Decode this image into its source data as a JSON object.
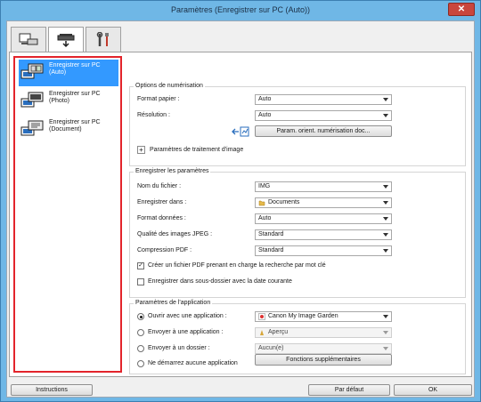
{
  "window": {
    "title": "Paramètres (Enregistrer sur PC (Auto))",
    "close": "✕"
  },
  "tabs": [
    {
      "icon": "scanner-computer-icon"
    },
    {
      "icon": "scanner-save-icon"
    },
    {
      "icon": "tools-icon"
    }
  ],
  "sidebar": {
    "items": [
      {
        "label": "Enregistrer sur PC\n(Auto)",
        "selected": true
      },
      {
        "label": "Enregistrer sur PC\n(Photo)",
        "selected": false
      },
      {
        "label": "Enregistrer sur PC\n(Document)",
        "selected": false
      }
    ]
  },
  "scan_options": {
    "title": "Options de numérisation",
    "paper_size_label": "Format papier :",
    "paper_size_value": "Auto",
    "resolution_label": "Résolution :",
    "resolution_value": "Auto",
    "orientation_button": "Param. orient. numérisation doc...",
    "image_processing_label": "Paramètres de traitement d'image",
    "expand_symbol": "+"
  },
  "save_settings": {
    "title": "Enregistrer les paramètres",
    "filename_label": "Nom du fichier :",
    "filename_value": "IMG",
    "save_in_label": "Enregistrer dans :",
    "save_in_value": "Documents",
    "data_format_label": "Format données :",
    "data_format_value": "Auto",
    "jpeg_quality_label": "Qualité des images JPEG :",
    "jpeg_quality_value": "Standard",
    "pdf_compression_label": "Compression PDF :",
    "pdf_compression_value": "Standard",
    "searchable_pdf_label": "Créer un fichier PDF prenant en charge la recherche par mot clé",
    "searchable_pdf_checked": true,
    "subfolder_label": "Enregistrer dans sous-dossier avec la date courante",
    "subfolder_checked": false,
    "check_mark": "✓"
  },
  "app_settings": {
    "title": "Paramètres de l'application",
    "open_app_label": "Ouvrir avec une application :",
    "open_app_value": "Canon My Image Garden",
    "send_app_label": "Envoyer à une application :",
    "send_app_value": "Aperçu",
    "send_folder_label": "Envoyer à un dossier :",
    "send_folder_value": "Aucun(e)",
    "no_app_label": "Ne démarrez aucune application",
    "selected_option": "open_app",
    "more_functions_button": "Fonctions supplémentaires"
  },
  "footer": {
    "instructions": "Instructions",
    "defaults": "Par défaut",
    "ok": "OK"
  },
  "colors": {
    "titlebar": "#6fb7e6",
    "selection": "#3399ff",
    "highlight_border": "#e3242b",
    "close": "#c9463d"
  }
}
